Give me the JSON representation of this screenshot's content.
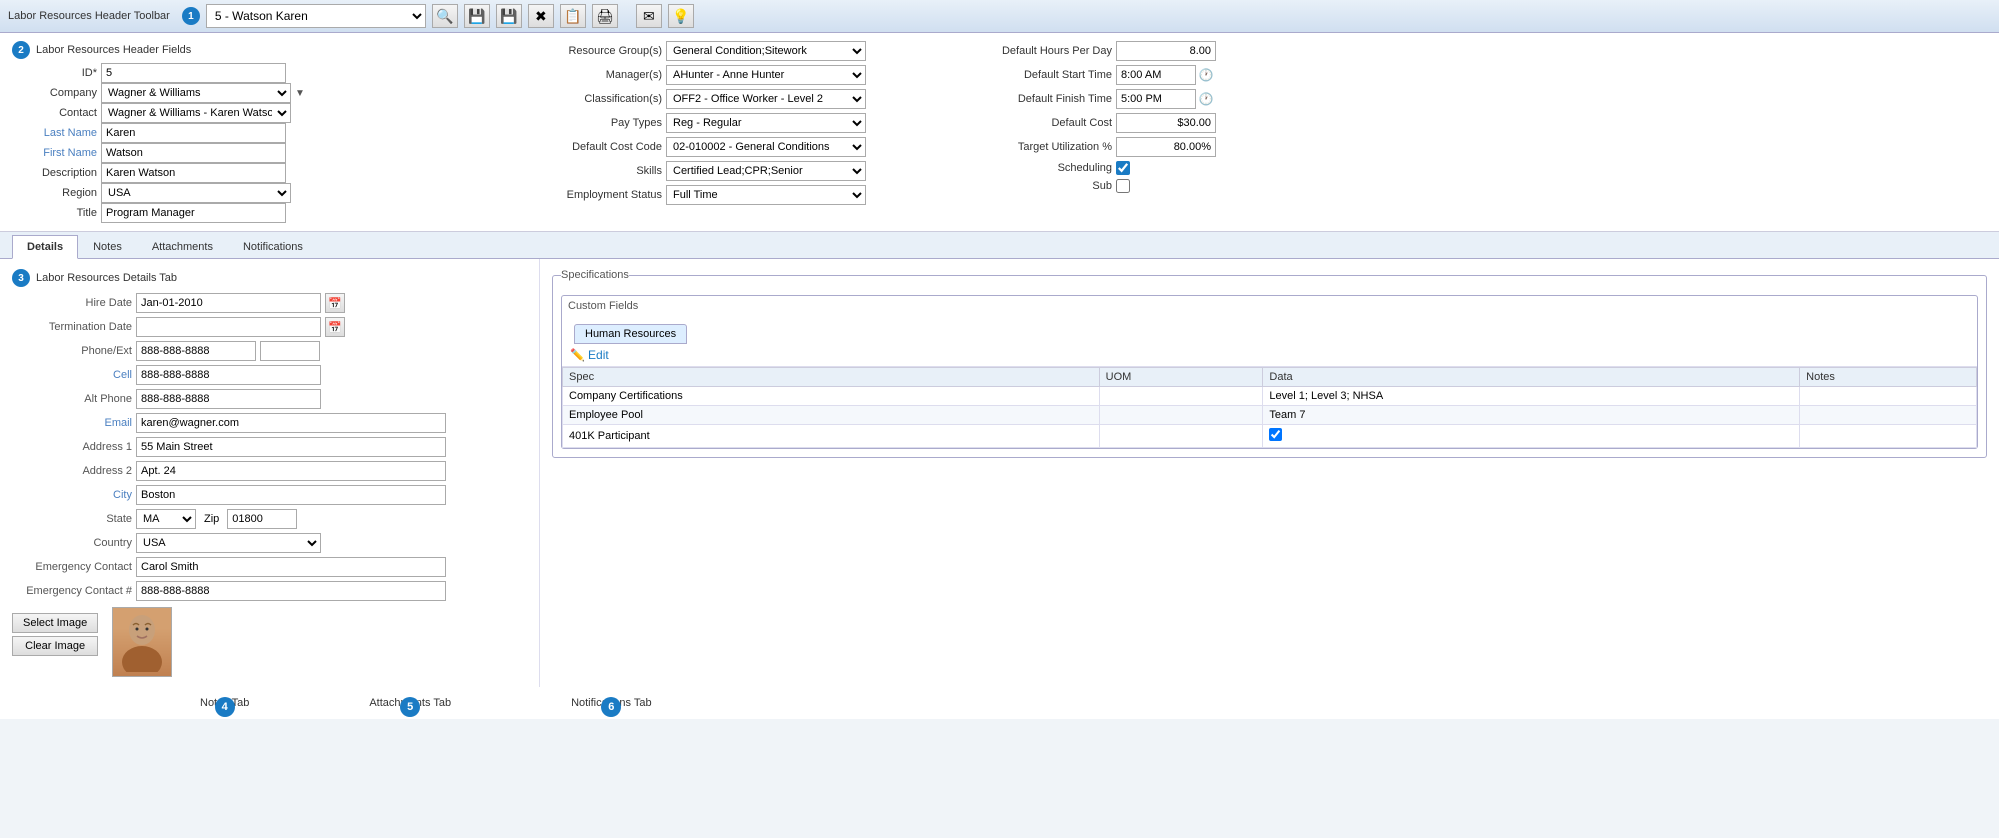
{
  "toolbar": {
    "label": "Labor Resources Header Toolbar",
    "badge": "1",
    "selected_record": "5 - Watson Karen",
    "search_icon": "🔍",
    "save_icon": "💾",
    "save2_icon": "💾",
    "delete_icon": "✖",
    "copy_icon": "📋",
    "print_icon": "🖨",
    "email_icon": "✉",
    "bulb_icon": "💡"
  },
  "header": {
    "label": "Labor Resources Header Fields",
    "badge": "2",
    "id_label": "ID*",
    "id_value": "5",
    "company_label": "Company",
    "company_value": "Wagner & Williams",
    "contact_label": "Contact",
    "contact_value": "Wagner & Williams - Karen Watson",
    "last_name_label": "Last Name",
    "last_name_value": "Karen",
    "first_name_label": "First Name",
    "first_name_value": "Watson",
    "description_label": "Description",
    "description_value": "Karen Watson",
    "region_label": "Region",
    "region_value": "USA",
    "title_label": "Title",
    "title_value": "Program Manager",
    "resource_group_label": "Resource Group(s)",
    "resource_group_value": "General Condition;Sitework",
    "managers_label": "Manager(s)",
    "managers_value": "AHunter - Anne Hunter",
    "classifications_label": "Classification(s)",
    "classifications_value": "OFF2 - Office Worker - Level 2",
    "pay_types_label": "Pay Types",
    "pay_types_value": "Reg - Regular",
    "default_cost_code_label": "Default Cost Code",
    "default_cost_code_value": "02-010002 - General Conditions",
    "skills_label": "Skills",
    "skills_value": "Certified Lead;CPR;Senior",
    "employment_status_label": "Employment Status",
    "employment_status_value": "Full Time",
    "default_hours_label": "Default Hours Per Day",
    "default_hours_value": "8.00",
    "default_start_label": "Default Start Time",
    "default_start_value": "8:00 AM",
    "default_finish_label": "Default Finish Time",
    "default_finish_value": "5:00 PM",
    "default_cost_label": "Default Cost",
    "default_cost_value": "$30.00",
    "target_util_label": "Target Utilization %",
    "target_util_value": "80.00%",
    "scheduling_label": "Scheduling",
    "sub_label": "Sub"
  },
  "tabs": {
    "details": "Details",
    "notes": "Notes",
    "attachments": "Attachments",
    "notifications": "Notifications"
  },
  "details": {
    "badge": "3",
    "label": "Labor Resources Details Tab",
    "hire_date_label": "Hire Date",
    "hire_date_value": "Jan-01-2010",
    "termination_date_label": "Termination Date",
    "termination_date_value": "",
    "phone_ext_label": "Phone/Ext",
    "phone_value": "888-888-8888",
    "phone_ext_value": "",
    "cell_label": "Cell",
    "cell_value": "888-888-8888",
    "alt_phone_label": "Alt Phone",
    "alt_phone_value": "888-888-8888",
    "email_label": "Email",
    "email_value": "karen@wagner.com",
    "address1_label": "Address 1",
    "address1_value": "55 Main Street",
    "address2_label": "Address 2",
    "address2_value": "Apt. 24",
    "city_label": "City",
    "city_value": "Boston",
    "state_label": "State",
    "state_value": "MA",
    "zip_label": "Zip",
    "zip_value": "01800",
    "country_label": "Country",
    "country_value": "USA",
    "emergency_contact_label": "Emergency Contact",
    "emergency_contact_value": "Carol Smith",
    "emergency_contact_num_label": "Emergency Contact #",
    "emergency_contact_num_value": "888-888-8888",
    "select_image_label": "Select Image",
    "clear_image_label": "Clear Image"
  },
  "specs": {
    "title": "Specifications",
    "custom_fields_title": "Custom Fields",
    "tab_label": "Human Resources",
    "edit_label": "Edit",
    "columns": [
      "Spec",
      "UOM",
      "Data",
      "Notes"
    ],
    "rows": [
      {
        "spec": "Company Certifications",
        "uom": "",
        "data": "Level 1; Level 3; NHSA",
        "notes": ""
      },
      {
        "spec": "Employee Pool",
        "uom": "",
        "data": "Team 7",
        "notes": ""
      },
      {
        "spec": "401K Participant",
        "uom": "",
        "data": "",
        "notes": "",
        "checkbox": true
      }
    ]
  },
  "annotations": {
    "notes_tab": {
      "badge": "4",
      "label": "Notes Tab"
    },
    "attachments_tab": {
      "badge": "5",
      "label": "Attachments Tab"
    },
    "notifications_tab": {
      "badge": "6",
      "label": "Notifications Tab"
    }
  }
}
